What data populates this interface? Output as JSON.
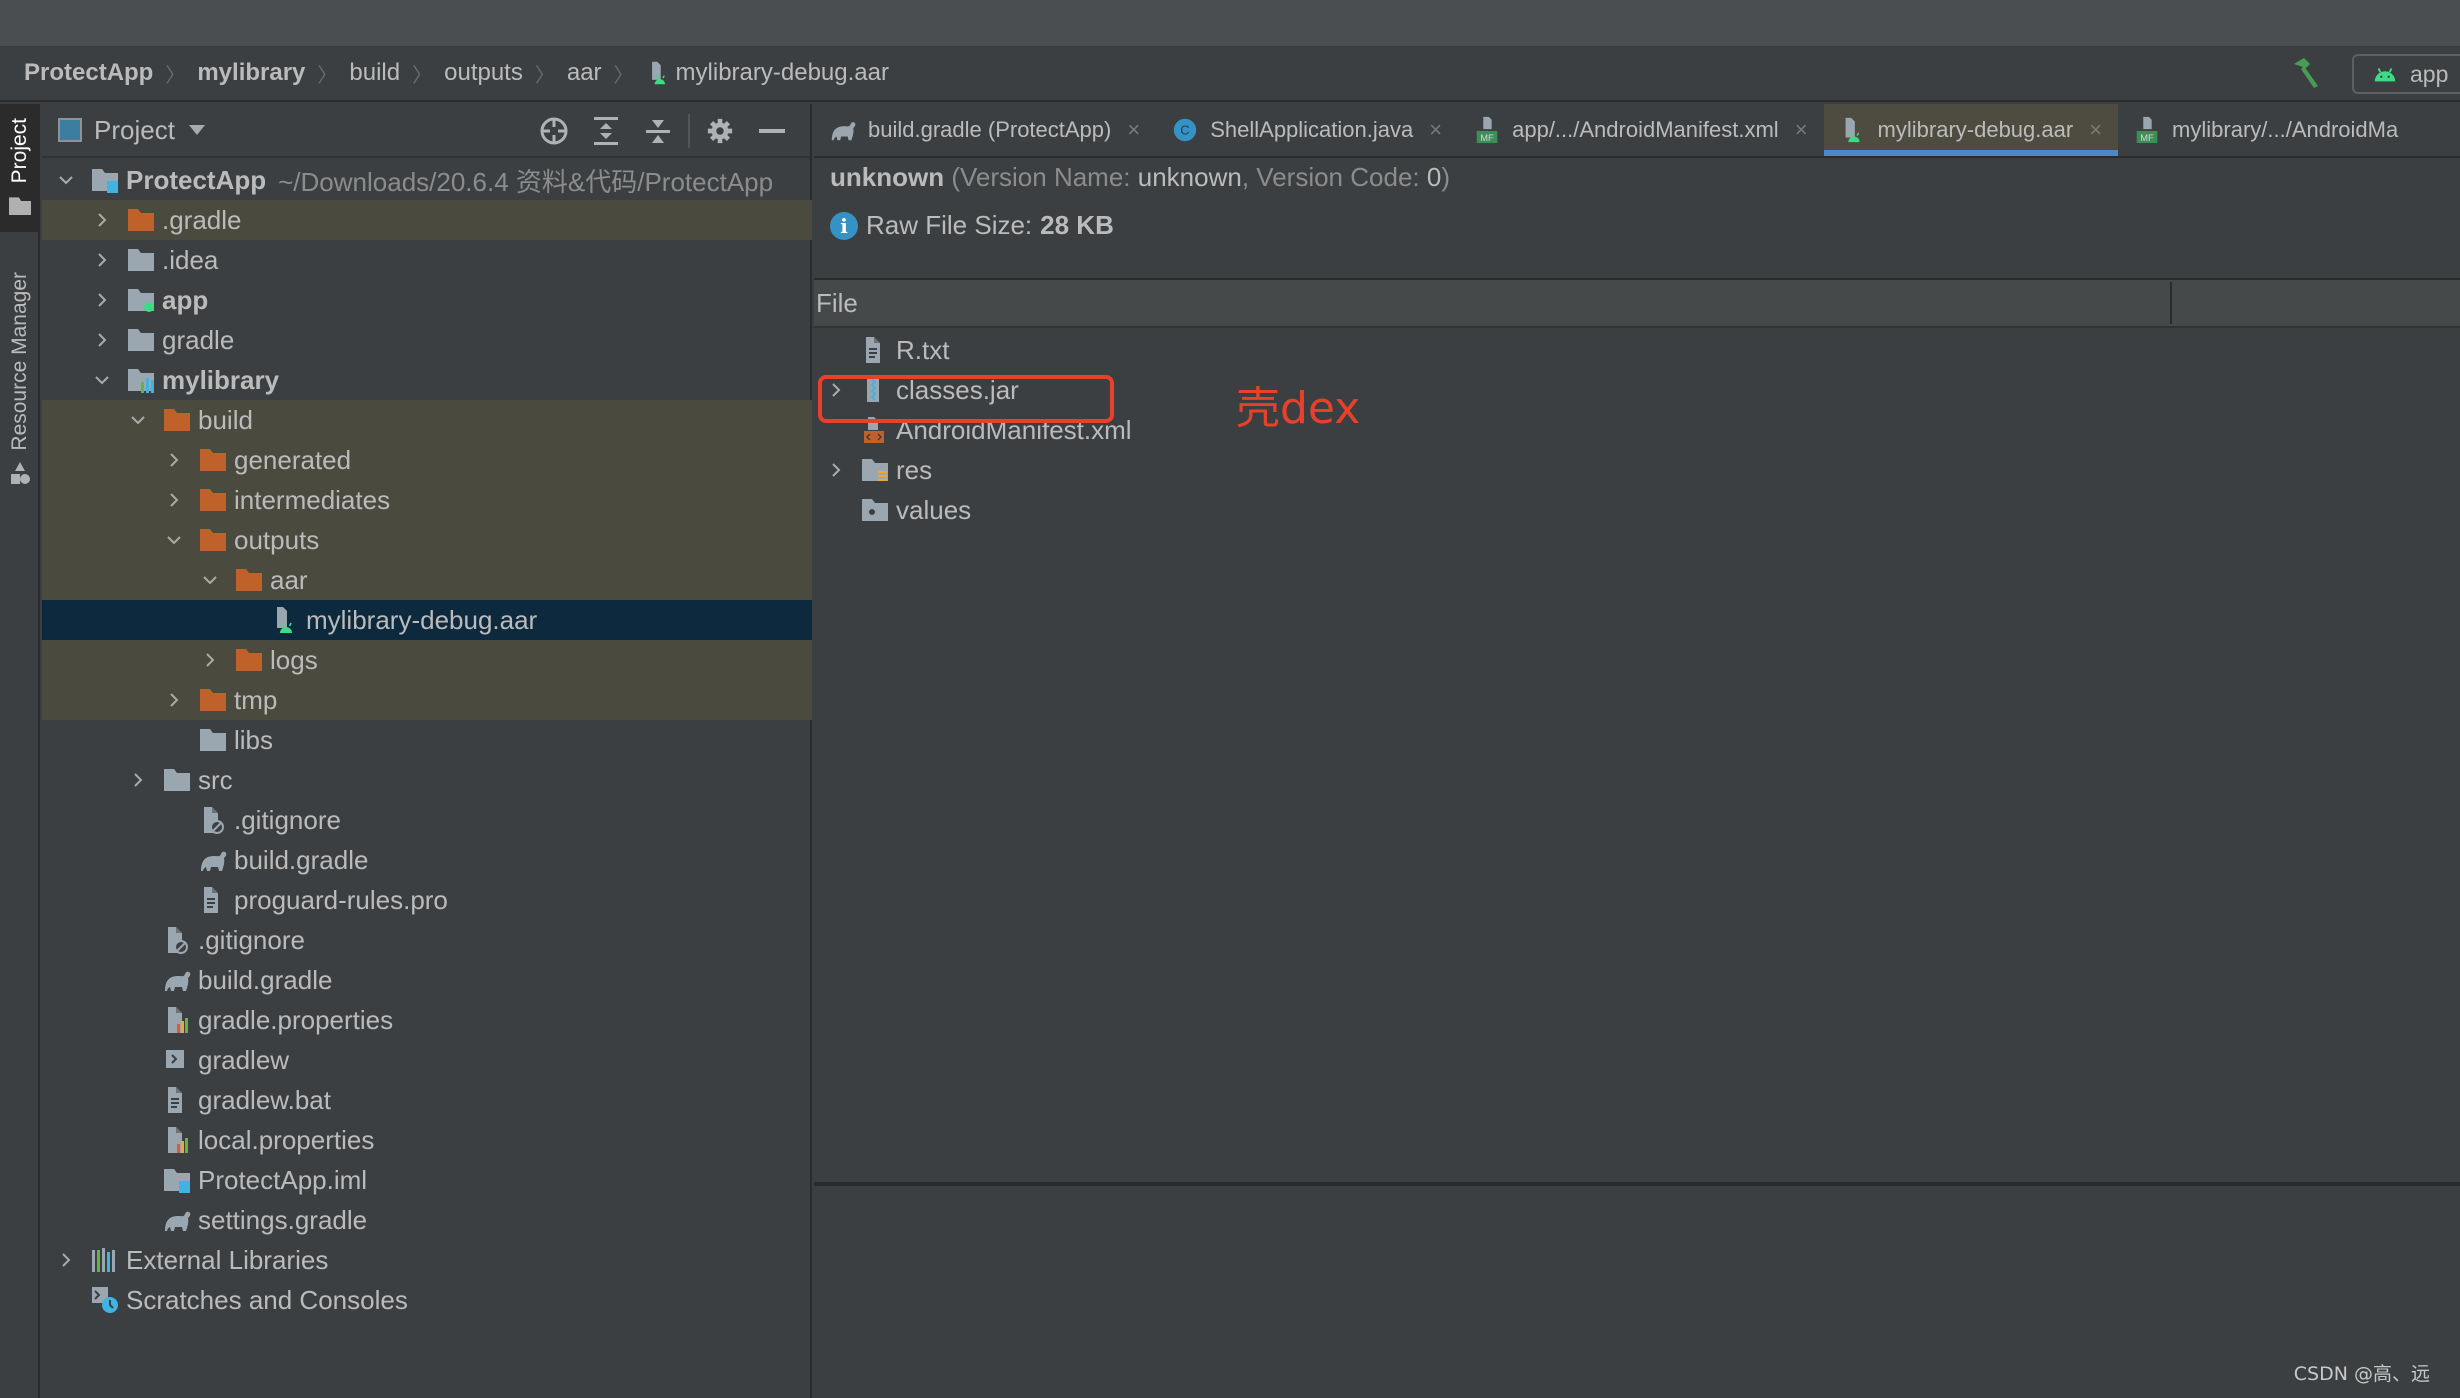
{
  "breadcrumb": [
    {
      "label": "ProtectApp",
      "bold": true
    },
    {
      "label": "mylibrary",
      "bold": true
    },
    {
      "label": "build",
      "bold": false
    },
    {
      "label": "outputs",
      "bold": false
    },
    {
      "label": "aar",
      "bold": false
    },
    {
      "label": "mylibrary-debug.aar",
      "bold": false,
      "icon": "aar-file-icon"
    }
  ],
  "toolbar": {
    "run_config_label": "app",
    "build_icon": "hammer-icon"
  },
  "tool_window_strip": {
    "tabs": [
      {
        "label": "Project",
        "active": true,
        "icon": "folder-icon"
      },
      {
        "label": "Resource Manager",
        "active": false,
        "icon": "shapes-icon"
      }
    ]
  },
  "project_panel": {
    "title": "Project",
    "tools": [
      "locate-icon",
      "expand-all-icon",
      "collapse-all-icon",
      "gear-icon",
      "hide-icon"
    ],
    "tree": [
      {
        "depth": 0,
        "chevron": "down",
        "icon": "module-icon",
        "label": "ProtectApp",
        "bold": true,
        "path": "~/Downloads/20.6.4 资料&代码/ProtectApp",
        "state": "normal"
      },
      {
        "depth": 1,
        "chevron": "right",
        "icon": "folder-orange-icon",
        "label": ".gradle",
        "state": "excluded"
      },
      {
        "depth": 1,
        "chevron": "right",
        "icon": "folder-icon",
        "label": ".idea",
        "state": "normal"
      },
      {
        "depth": 1,
        "chevron": "right",
        "icon": "app-module-icon",
        "label": "app",
        "bold": true,
        "state": "normal"
      },
      {
        "depth": 1,
        "chevron": "right",
        "icon": "folder-icon",
        "label": "gradle",
        "state": "normal"
      },
      {
        "depth": 1,
        "chevron": "down",
        "icon": "library-module-icon",
        "label": "mylibrary",
        "bold": true,
        "state": "normal"
      },
      {
        "depth": 2,
        "chevron": "down",
        "icon": "folder-orange-icon",
        "label": "build",
        "state": "excluded"
      },
      {
        "depth": 3,
        "chevron": "right",
        "icon": "folder-orange-icon",
        "label": "generated",
        "state": "excluded"
      },
      {
        "depth": 3,
        "chevron": "right",
        "icon": "folder-orange-icon",
        "label": "intermediates",
        "state": "excluded"
      },
      {
        "depth": 3,
        "chevron": "down",
        "icon": "folder-orange-icon",
        "label": "outputs",
        "state": "excluded"
      },
      {
        "depth": 4,
        "chevron": "down",
        "icon": "folder-orange-icon",
        "label": "aar",
        "state": "excluded"
      },
      {
        "depth": 5,
        "chevron": "none",
        "icon": "aar-file-icon",
        "label": "mylibrary-debug.aar",
        "state": "selected"
      },
      {
        "depth": 4,
        "chevron": "right",
        "icon": "folder-orange-icon",
        "label": "logs",
        "state": "excluded"
      },
      {
        "depth": 3,
        "chevron": "right",
        "icon": "folder-orange-icon",
        "label": "tmp",
        "state": "excluded"
      },
      {
        "depth": 3,
        "chevron": "none",
        "icon": "folder-icon",
        "label": "libs",
        "state": "normal"
      },
      {
        "depth": 2,
        "chevron": "right",
        "icon": "folder-icon",
        "label": "src",
        "state": "normal"
      },
      {
        "depth": 3,
        "chevron": "none",
        "icon": "gitignore-icon",
        "label": ".gitignore",
        "state": "normal"
      },
      {
        "depth": 3,
        "chevron": "none",
        "icon": "gradle-icon",
        "label": "build.gradle",
        "state": "normal"
      },
      {
        "depth": 3,
        "chevron": "none",
        "icon": "text-file-icon",
        "label": "proguard-rules.pro",
        "state": "normal"
      },
      {
        "depth": 2,
        "chevron": "none",
        "icon": "gitignore-icon",
        "label": ".gitignore",
        "state": "normal"
      },
      {
        "depth": 2,
        "chevron": "none",
        "icon": "gradle-icon",
        "label": "build.gradle",
        "state": "normal"
      },
      {
        "depth": 2,
        "chevron": "none",
        "icon": "properties-icon",
        "label": "gradle.properties",
        "state": "normal"
      },
      {
        "depth": 2,
        "chevron": "none",
        "icon": "shell-script-icon",
        "label": "gradlew",
        "state": "normal"
      },
      {
        "depth": 2,
        "chevron": "none",
        "icon": "text-file-icon",
        "label": "gradlew.bat",
        "state": "normal"
      },
      {
        "depth": 2,
        "chevron": "none",
        "icon": "properties-icon",
        "label": "local.properties",
        "state": "normal"
      },
      {
        "depth": 2,
        "chevron": "none",
        "icon": "iml-icon",
        "label": "ProtectApp.iml",
        "state": "normal"
      },
      {
        "depth": 2,
        "chevron": "none",
        "icon": "gradle-icon",
        "label": "settings.gradle",
        "state": "normal"
      },
      {
        "depth": 0,
        "chevron": "right",
        "icon": "external-libraries-icon",
        "label": "External Libraries",
        "state": "normal"
      },
      {
        "depth": 0,
        "chevron": "none",
        "icon": "scratches-icon",
        "label": "Scratches and Consoles",
        "state": "normal"
      }
    ]
  },
  "editor": {
    "tabs": [
      {
        "label": "build.gradle (ProtectApp)",
        "icon": "gradle-icon",
        "active": false
      },
      {
        "label": "ShellApplication.java",
        "icon": "java-class-icon",
        "active": false
      },
      {
        "label": "app/.../AndroidManifest.xml",
        "icon": "manifest-icon",
        "active": false
      },
      {
        "label": "mylibrary-debug.aar",
        "icon": "aar-file-icon",
        "active": true
      },
      {
        "label": "mylibrary/.../AndroidMa",
        "icon": "manifest-icon",
        "active": false
      }
    ],
    "close_glyph": "×",
    "apk_info": {
      "name": "unknown",
      "version_name_label": "Version Name:",
      "version_name": "unknown",
      "version_code_label": "Version Code:",
      "version_code": "0",
      "raw_size_label": "Raw File Size:",
      "raw_size": "28 KB"
    },
    "file_table": {
      "column": "File",
      "rows": [
        {
          "chevron": "none",
          "icon": "text-file-icon",
          "label": "R.txt"
        },
        {
          "chevron": "right",
          "icon": "jar-icon",
          "label": "classes.jar",
          "highlighted": true
        },
        {
          "chevron": "none",
          "icon": "xml-file-icon",
          "label": "AndroidManifest.xml"
        },
        {
          "chevron": "right",
          "icon": "res-folder-icon",
          "label": "res"
        },
        {
          "chevron": "none",
          "icon": "values-folder-icon",
          "label": "values"
        }
      ]
    },
    "annotation": "壳dex"
  },
  "colors": {
    "accent_tab_underline": "#4a88c7",
    "annotation_red": "#e8402a",
    "android_green": "#3ddc84",
    "excluded_row": "#4b4a3f",
    "selected_row": "#0d293e"
  },
  "watermark": "CSDN @高、远"
}
